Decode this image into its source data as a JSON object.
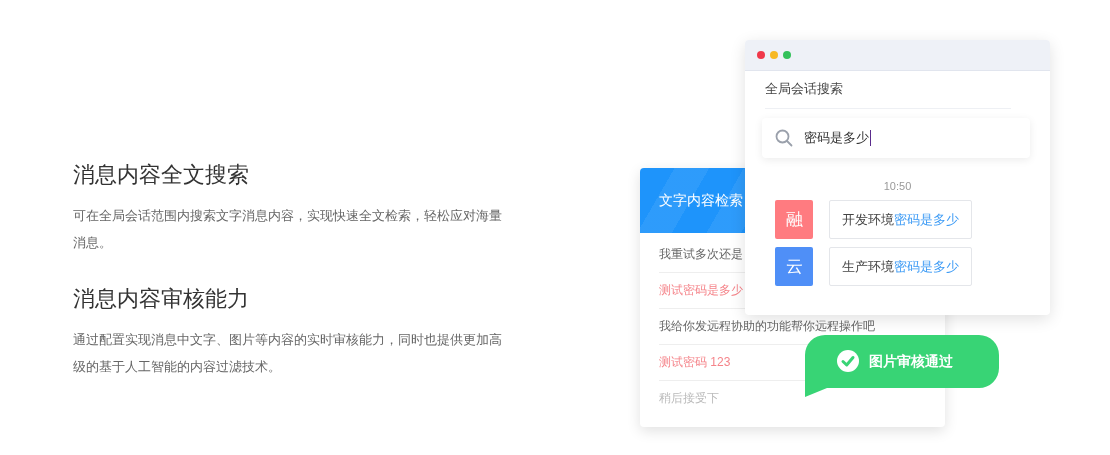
{
  "features": [
    {
      "title": "消息内容全文搜索",
      "description": "可在全局会话范围内搜索文字消息内容，实现快速全文检索，轻松应对海量消息。"
    },
    {
      "title": "消息内容审核能力",
      "description": "通过配置实现消息中文字、图片等内容的实时审核能力，同时也提供更加高级的基于人工智能的内容过滤技术。"
    }
  ],
  "text_search_card": {
    "title": "文字内容检索",
    "items": [
      {
        "text": "我重试多次还是",
        "kind": "normal"
      },
      {
        "text": "测试密码是多少",
        "kind": "flagged"
      },
      {
        "text": "我给你发远程协助的功能帮你远程操作吧",
        "kind": "normal"
      },
      {
        "text": "测试密码 123",
        "kind": "flagged"
      },
      {
        "text": "稍后接受下",
        "kind": "faded"
      }
    ]
  },
  "search_window": {
    "title": "全局会话搜索",
    "search": {
      "value": "密码是多少"
    },
    "time": "10:50",
    "messages": [
      {
        "avatar": "融",
        "color": "#ff7b80",
        "text": "开发环境",
        "highlight": "密码是多少"
      },
      {
        "avatar": "云",
        "color": "#4f8ff7",
        "text": "生产环境",
        "highlight": "密码是多少"
      }
    ]
  },
  "review_badge": {
    "text": "图片审核通过"
  }
}
